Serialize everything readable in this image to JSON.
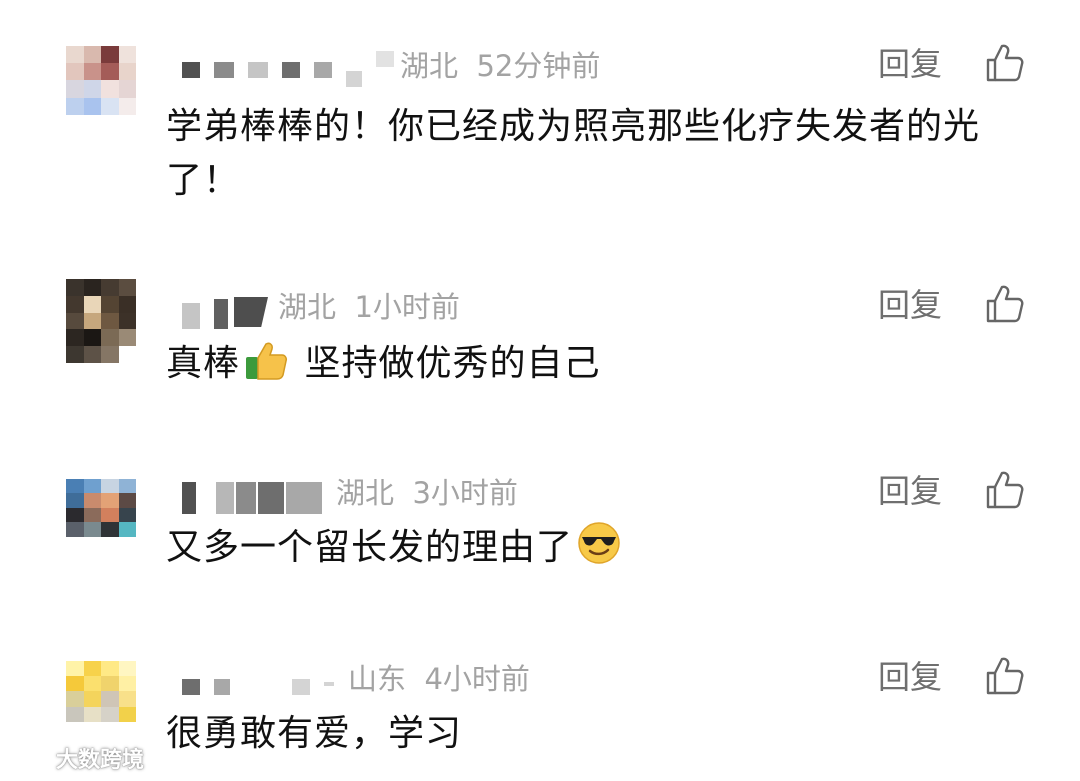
{
  "comments": [
    {
      "location": "湖北",
      "time": "52分钟前",
      "reply_label": "回复",
      "text": "学弟棒棒的！你已经成为照亮那些化疗失发者的光了！",
      "emoji": ""
    },
    {
      "location": "湖北",
      "time": "1小时前",
      "reply_label": "回复",
      "text_before": "真棒",
      "text_after": " 坚持做优秀的自己",
      "emoji": "thumbs-up-icon"
    },
    {
      "location": "湖北",
      "time": "3小时前",
      "reply_label": "回复",
      "text_before": "又多一个留长发的理由了",
      "emoji": "sunglasses-face-icon"
    },
    {
      "location": "山东",
      "time": "4小时前",
      "reply_label": "回复",
      "text": "很勇敢有爱，学习",
      "emoji": ""
    }
  ],
  "watermark": {
    "text": "大数跨境"
  }
}
